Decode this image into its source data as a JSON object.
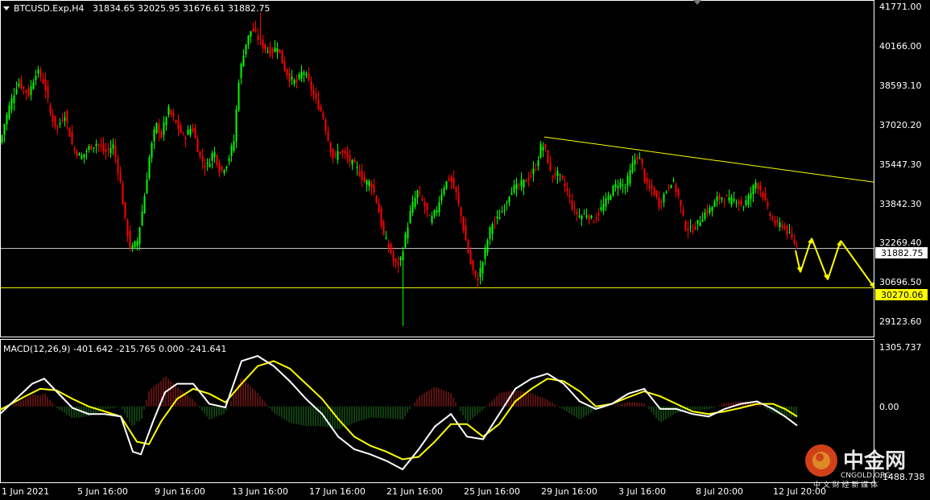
{
  "header": {
    "symbol": "BTCUSD.Exp,H4",
    "ohlc": "31834.65 32025.95 31676.61 31882.75"
  },
  "macd_header": "MACD(12,26,9) -401.642 -215.765 0.000 -241.641",
  "price_axis_labels": [
    "41771.00",
    "40166.00",
    "38593.10",
    "37020.20",
    "35447.30",
    "33842.30",
    "32269.40",
    "30696.50",
    "29123.60"
  ],
  "macd_axis_labels": [
    "1305.737",
    "0.00",
    "-1488.738"
  ],
  "current_price_tag": "31882.75",
  "support_price_tag": "30270.06",
  "time_labels": [
    "1 Jun 2021",
    "5 Jun 16:00",
    "9 Jun 16:00",
    "13 Jun 16:00",
    "17 Jun 16:00",
    "21 Jun 16:00",
    "25 Jun 16:00",
    "29 Jun 16:00",
    "3 Jul 16:00",
    "8 Jul 20:00",
    "12 Jul 20:00"
  ],
  "watermark": {
    "main": "中金网",
    "latin": "CNGOLD.ORG",
    "sub": "中 文 财 经 新 媒 体"
  },
  "colors": {
    "background": "#000000",
    "bull": "#00ff00",
    "bear": "#ff0000",
    "trendline": "#ffff00",
    "signal": "#ffff00",
    "macd_line": "#ffffff",
    "hist_pos": "#b22222",
    "hist_neg": "#1f7a1f"
  },
  "chart_data": {
    "type": "candlestick",
    "price_ylim": [
      28300,
      42000
    ],
    "current_price": 31882.75,
    "support_level": 30270.06,
    "close_path": [
      [
        0,
        36200
      ],
      [
        5,
        37000
      ],
      [
        12,
        37800
      ],
      [
        22,
        38700
      ],
      [
        35,
        38200
      ],
      [
        45,
        39200
      ],
      [
        55,
        38600
      ],
      [
        62,
        37400
      ],
      [
        70,
        36800
      ],
      [
        80,
        37400
      ],
      [
        90,
        36000
      ],
      [
        100,
        35600
      ],
      [
        110,
        36000
      ],
      [
        120,
        36200
      ],
      [
        130,
        35800
      ],
      [
        140,
        36100
      ],
      [
        148,
        34800
      ],
      [
        155,
        33000
      ],
      [
        162,
        31800
      ],
      [
        170,
        32200
      ],
      [
        178,
        33800
      ],
      [
        185,
        35600
      ],
      [
        193,
        37000
      ],
      [
        200,
        36500
      ],
      [
        208,
        37600
      ],
      [
        218,
        37000
      ],
      [
        228,
        36400
      ],
      [
        238,
        36900
      ],
      [
        248,
        35600
      ],
      [
        256,
        35200
      ],
      [
        265,
        35900
      ],
      [
        273,
        35000
      ],
      [
        282,
        35400
      ],
      [
        290,
        36300
      ],
      [
        296,
        38800
      ],
      [
        303,
        40100
      ],
      [
        312,
        40900
      ],
      [
        320,
        40500
      ],
      [
        328,
        40100
      ],
      [
        336,
        39900
      ],
      [
        344,
        40200
      ],
      [
        352,
        39300
      ],
      [
        360,
        38800
      ],
      [
        368,
        38700
      ],
      [
        376,
        39200
      ],
      [
        384,
        38600
      ],
      [
        392,
        37900
      ],
      [
        400,
        37400
      ],
      [
        408,
        36200
      ],
      [
        414,
        35500
      ],
      [
        420,
        35900
      ],
      [
        428,
        35700
      ],
      [
        436,
        35400
      ],
      [
        444,
        35100
      ],
      [
        452,
        34600
      ],
      [
        460,
        34600
      ],
      [
        468,
        33700
      ],
      [
        476,
        32400
      ],
      [
        484,
        31800
      ],
      [
        490,
        31200
      ],
      [
        496,
        31300
      ],
      [
        502,
        32200
      ],
      [
        510,
        33500
      ],
      [
        518,
        34200
      ],
      [
        526,
        33700
      ],
      [
        534,
        33000
      ],
      [
        542,
        33500
      ],
      [
        550,
        34400
      ],
      [
        558,
        34800
      ],
      [
        566,
        34100
      ],
      [
        572,
        33200
      ],
      [
        578,
        32200
      ],
      [
        585,
        31100
      ],
      [
        592,
        30600
      ],
      [
        598,
        31200
      ],
      [
        604,
        32100
      ],
      [
        610,
        32900
      ],
      [
        618,
        33100
      ],
      [
        626,
        33600
      ],
      [
        634,
        34300
      ],
      [
        642,
        34400
      ],
      [
        650,
        34600
      ],
      [
        658,
        34800
      ],
      [
        666,
        35300
      ],
      [
        672,
        36200
      ],
      [
        678,
        35800
      ],
      [
        684,
        34800
      ],
      [
        690,
        35000
      ],
      [
        697,
        34700
      ],
      [
        704,
        34200
      ],
      [
        712,
        33400
      ],
      [
        720,
        33200
      ],
      [
        728,
        33300
      ],
      [
        736,
        33000
      ],
      [
        744,
        33400
      ],
      [
        752,
        33800
      ],
      [
        760,
        34300
      ],
      [
        768,
        34600
      ],
      [
        776,
        34400
      ],
      [
        784,
        35200
      ],
      [
        790,
        35700
      ],
      [
        796,
        35400
      ],
      [
        802,
        34400
      ],
      [
        810,
        34300
      ],
      [
        818,
        33700
      ],
      [
        826,
        34200
      ],
      [
        834,
        34700
      ],
      [
        842,
        34000
      ],
      [
        850,
        32800
      ],
      [
        858,
        32600
      ],
      [
        866,
        32900
      ],
      [
        874,
        33300
      ],
      [
        882,
        33500
      ],
      [
        890,
        33900
      ],
      [
        898,
        34000
      ],
      [
        906,
        33800
      ],
      [
        914,
        33900
      ],
      [
        922,
        33600
      ],
      [
        930,
        34000
      ],
      [
        938,
        34600
      ],
      [
        946,
        34200
      ],
      [
        952,
        33500
      ],
      [
        958,
        33100
      ],
      [
        964,
        32800
      ],
      [
        970,
        32900
      ],
      [
        978,
        32500
      ],
      [
        986,
        32100
      ],
      [
        990,
        31900
      ]
    ],
    "volatility": 260,
    "resistance_trendline": {
      "from": [
        676,
        36450
      ],
      "to": [
        1085,
        34600
      ]
    },
    "projection_path": [
      [
        988,
        31800
      ],
      [
        994,
        30900
      ],
      [
        1008,
        32300
      ],
      [
        1028,
        30600
      ],
      [
        1044,
        32200
      ],
      [
        1086,
        30270
      ]
    ],
    "macd": {
      "ylim": [
        -1488.738,
        1305.737
      ],
      "main_line": [
        [
          0,
          -150
        ],
        [
          20,
          150
        ],
        [
          40,
          450
        ],
        [
          55,
          550
        ],
        [
          70,
          300
        ],
        [
          90,
          -30
        ],
        [
          110,
          -150
        ],
        [
          130,
          -150
        ],
        [
          150,
          -200
        ],
        [
          165,
          -900
        ],
        [
          175,
          -950
        ],
        [
          190,
          -300
        ],
        [
          205,
          280
        ],
        [
          220,
          450
        ],
        [
          240,
          450
        ],
        [
          260,
          50
        ],
        [
          280,
          -20
        ],
        [
          300,
          900
        ],
        [
          320,
          1000
        ],
        [
          340,
          800
        ],
        [
          360,
          500
        ],
        [
          380,
          150
        ],
        [
          400,
          -150
        ],
        [
          420,
          -600
        ],
        [
          440,
          -850
        ],
        [
          460,
          -950
        ],
        [
          480,
          -1080
        ],
        [
          500,
          -1250
        ],
        [
          520,
          -850
        ],
        [
          540,
          -400
        ],
        [
          560,
          -150
        ],
        [
          580,
          -600
        ],
        [
          600,
          -650
        ],
        [
          620,
          -150
        ],
        [
          640,
          350
        ],
        [
          660,
          550
        ],
        [
          680,
          650
        ],
        [
          700,
          450
        ],
        [
          720,
          100
        ],
        [
          740,
          -50
        ],
        [
          760,
          50
        ],
        [
          780,
          250
        ],
        [
          800,
          350
        ],
        [
          820,
          -50
        ],
        [
          840,
          -50
        ],
        [
          860,
          -150
        ],
        [
          880,
          -200
        ],
        [
          900,
          -50
        ],
        [
          920,
          50
        ],
        [
          940,
          100
        ],
        [
          960,
          -50
        ],
        [
          975,
          -200
        ],
        [
          990,
          -380
        ]
      ],
      "signal_line": [
        [
          0,
          -70
        ],
        [
          30,
          190
        ],
        [
          50,
          350
        ],
        [
          70,
          320
        ],
        [
          90,
          150
        ],
        [
          110,
          0
        ],
        [
          130,
          -100
        ],
        [
          150,
          -200
        ],
        [
          170,
          -700
        ],
        [
          185,
          -750
        ],
        [
          200,
          -300
        ],
        [
          220,
          150
        ],
        [
          240,
          350
        ],
        [
          260,
          250
        ],
        [
          280,
          80
        ],
        [
          300,
          450
        ],
        [
          320,
          800
        ],
        [
          340,
          900
        ],
        [
          360,
          750
        ],
        [
          380,
          450
        ],
        [
          400,
          150
        ],
        [
          420,
          -250
        ],
        [
          440,
          -600
        ],
        [
          460,
          -780
        ],
        [
          480,
          -900
        ],
        [
          500,
          -1050
        ],
        [
          520,
          -1000
        ],
        [
          540,
          -700
        ],
        [
          560,
          -350
        ],
        [
          580,
          -350
        ],
        [
          600,
          -600
        ],
        [
          620,
          -350
        ],
        [
          640,
          100
        ],
        [
          660,
          350
        ],
        [
          680,
          550
        ],
        [
          700,
          500
        ],
        [
          720,
          300
        ],
        [
          740,
          0
        ],
        [
          760,
          50
        ],
        [
          780,
          180
        ],
        [
          800,
          300
        ],
        [
          820,
          200
        ],
        [
          840,
          50
        ],
        [
          860,
          -100
        ],
        [
          880,
          -150
        ],
        [
          900,
          -100
        ],
        [
          920,
          -30
        ],
        [
          940,
          50
        ],
        [
          960,
          50
        ],
        [
          975,
          -50
        ],
        [
          990,
          -200
        ]
      ]
    }
  }
}
